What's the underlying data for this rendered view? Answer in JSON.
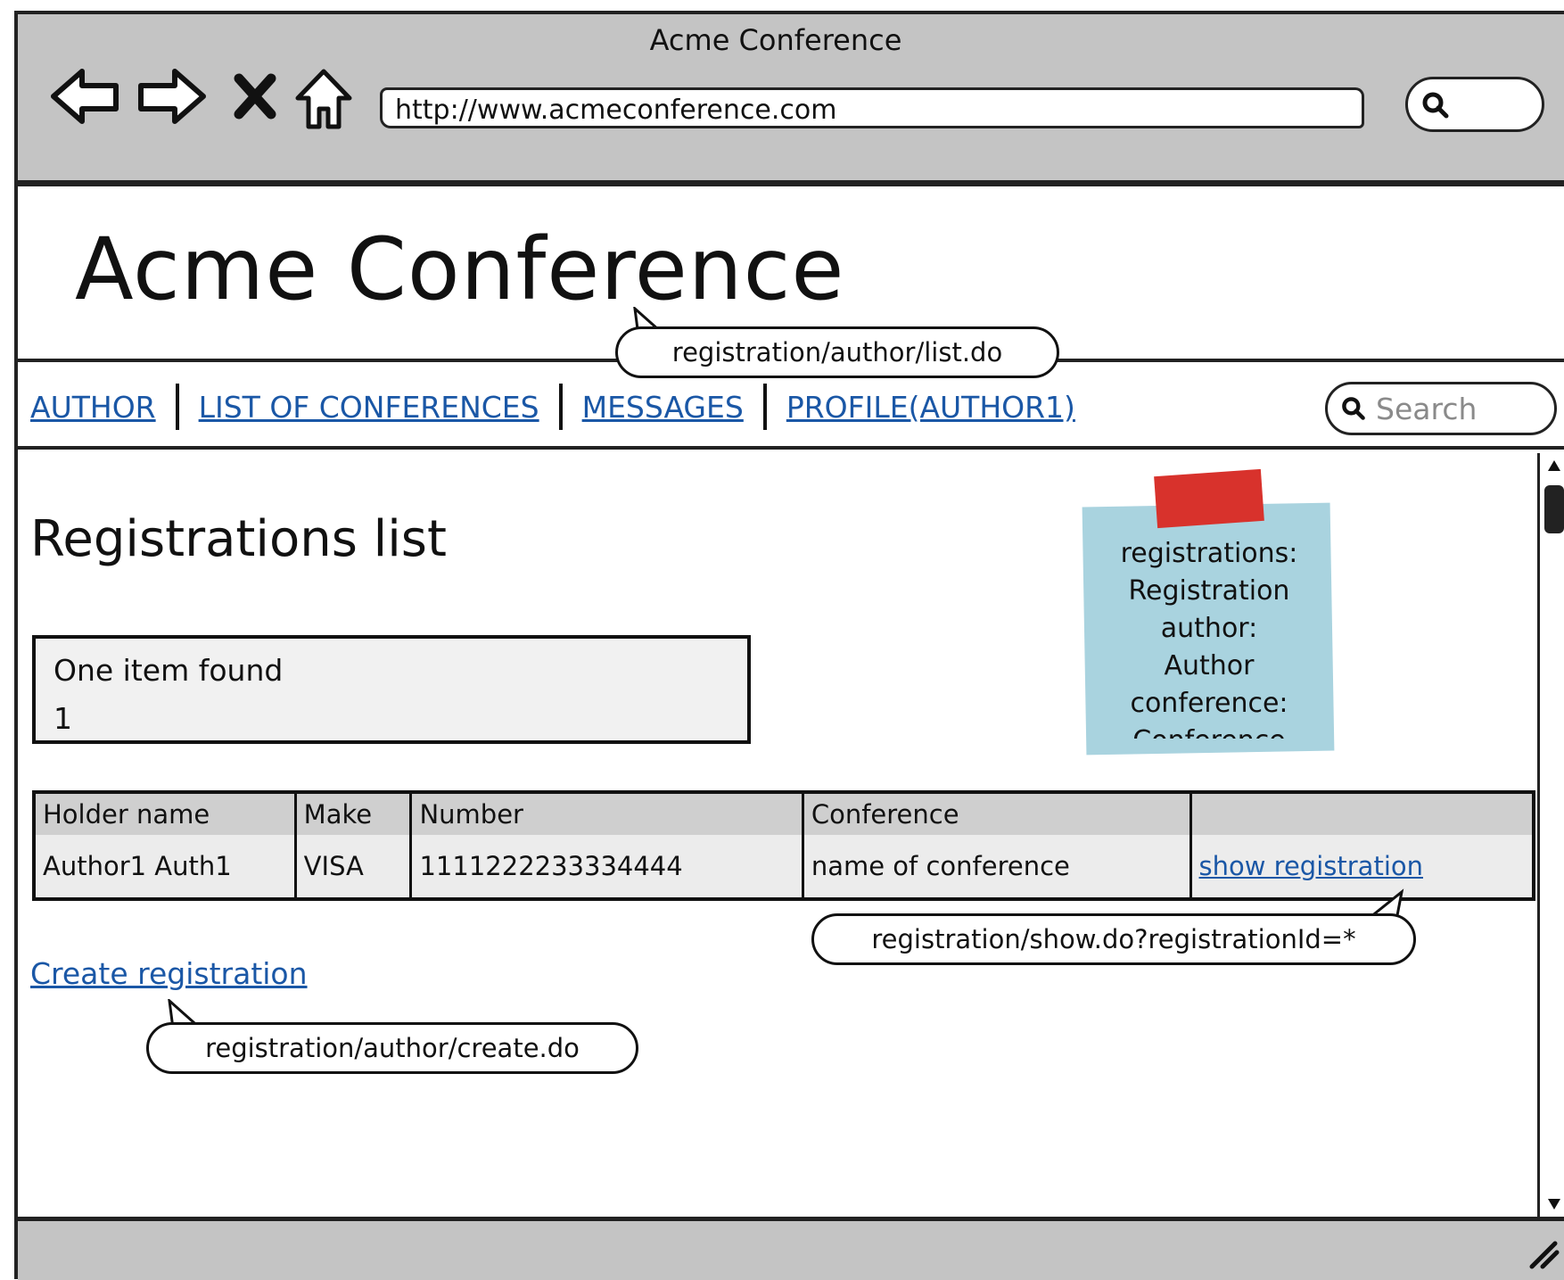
{
  "window": {
    "title": "Acme Conference",
    "url": "http://www.acmeconference.com"
  },
  "header": {
    "title": "Acme Conference"
  },
  "nav": {
    "items": [
      {
        "label": "AUTHOR"
      },
      {
        "label": "LIST OF CONFERENCES"
      },
      {
        "label": "MESSAGES"
      },
      {
        "label": "PROFILE(AUTHOR1)"
      }
    ],
    "search_placeholder": "Search"
  },
  "page": {
    "heading": "Registrations list",
    "count_label": "One item found",
    "count_value": "1",
    "table": {
      "headers": [
        "Holder name",
        "Make",
        "Number",
        "Conference",
        ""
      ],
      "rows": [
        [
          "Author1 Auth1",
          "VISA",
          "1111222233334444",
          "name of conference",
          "show registration"
        ]
      ]
    },
    "create_link": "Create registration"
  },
  "note": {
    "lines": [
      "registrations:",
      "Registration",
      "author:",
      "Author",
      "conference:",
      "Conference"
    ]
  },
  "callouts": {
    "list": "registration/author/list.do",
    "show": "registration/show.do?registrationId=*",
    "create": "registration/author/create.do"
  }
}
